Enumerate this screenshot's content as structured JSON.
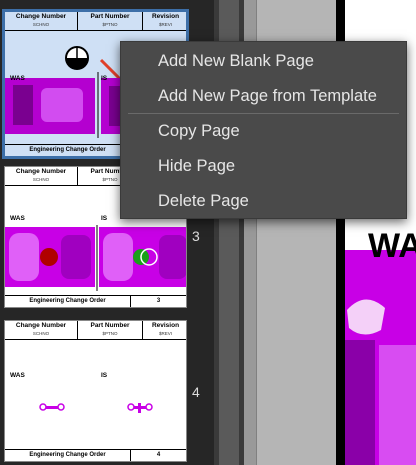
{
  "thumbnails": [
    {
      "header": {
        "c1_title": "Change Number",
        "c1_sub": "SCHNO",
        "c2_title": "Part Number",
        "c2_sub": "$PTNO",
        "c3_title": "Revision",
        "c3_sub": "$REVI"
      },
      "was": "WAS",
      "is": "IS",
      "footer": "Engineering Change Order",
      "footer_num": ""
    },
    {
      "header": {
        "c1_title": "Change Number",
        "c1_sub": "SCHNO",
        "c2_title": "Part Number",
        "c2_sub": "$PTNO",
        "c3_title": "",
        "c3_sub": ""
      },
      "was": "WAS",
      "is": "IS",
      "footer": "Engineering Change Order",
      "footer_num": "3"
    },
    {
      "header": {
        "c1_title": "Change Number",
        "c1_sub": "SCHNO",
        "c2_title": "Part Number",
        "c2_sub": "$PTNO",
        "c3_title": "Revision",
        "c3_sub": "$REVI"
      },
      "was": "WAS",
      "is": "IS",
      "footer": "Engineering Change Order",
      "footer_num": "4"
    }
  ],
  "page_numbers": [
    "3",
    "4"
  ],
  "canvas": {
    "big_text": "WA"
  },
  "context_menu": {
    "items": [
      "Add New Blank Page",
      "Add New Page from Template",
      "Copy Page",
      "Hide Page",
      "Delete Page"
    ]
  },
  "colors": {
    "accent": "#3d6fa8",
    "part_magenta": "#c800e6",
    "menu_bg": "#4a4a4a"
  }
}
